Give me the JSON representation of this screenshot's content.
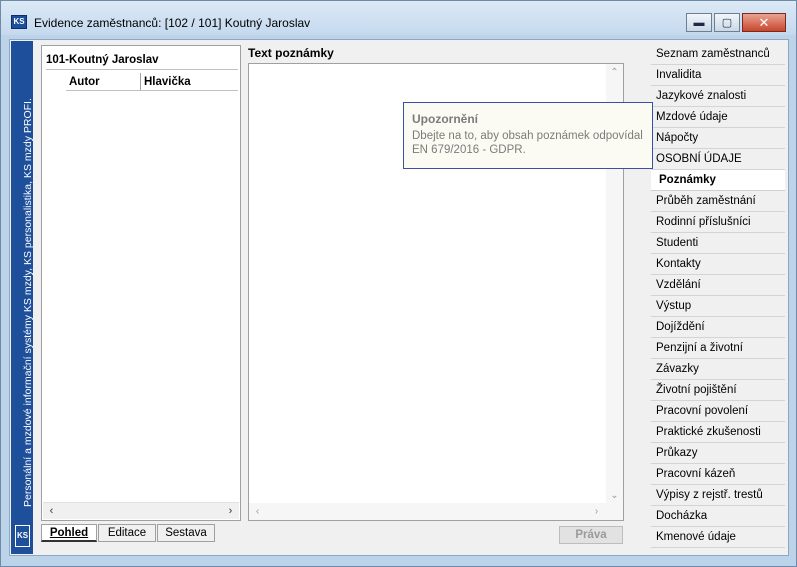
{
  "window": {
    "title": "Evidence zaměstnanců: [102 / 101] Koutný Jaroslav",
    "icon_label": "KS",
    "buttons": {
      "minimize": "▬",
      "maximize": "▢",
      "close": "✕"
    }
  },
  "brand": {
    "vertical_text": "Personální a mzdové informační systémy KS mzdy, KS personalistika, KS mzdy PROFI.",
    "logo": "KS",
    "color": "#1d4f9a"
  },
  "tree": {
    "root_item": "101-Koutný Jaroslav",
    "columns": [
      "Autor",
      "Hlavička"
    ]
  },
  "bottom_tabs": [
    {
      "label": "Pohled",
      "active": true
    },
    {
      "label": "Editace",
      "active": false
    },
    {
      "label": "Sestava",
      "active": false
    }
  ],
  "note": {
    "label": "Text poznámky",
    "content": ""
  },
  "rights_button": "Práva",
  "tooltip": {
    "title": "Upozornění",
    "body": "Dbejte na to, aby obsah poznámek odpovídal EN 679/2016 - GDPR.",
    "border_color": "#3a4fa8"
  },
  "menu": [
    {
      "label": "Seznam zaměstnanců",
      "active": false
    },
    {
      "label": "Invalidita",
      "active": false
    },
    {
      "label": "Jazykové znalosti",
      "active": false
    },
    {
      "label": "Mzdové údaje",
      "active": false
    },
    {
      "label": "Nápočty",
      "active": false
    },
    {
      "label": "OSOBNÍ ÚDAJE",
      "active": false
    },
    {
      "label": "Poznámky",
      "active": true
    },
    {
      "label": "Průběh zaměstnání",
      "active": false
    },
    {
      "label": "Rodinní příslušníci",
      "active": false
    },
    {
      "label": "Studenti",
      "active": false
    },
    {
      "label": "Kontakty",
      "active": false
    },
    {
      "label": "Vzdělání",
      "active": false
    },
    {
      "label": "Výstup",
      "active": false
    },
    {
      "label": "Dojíždění",
      "active": false
    },
    {
      "label": "Penzijní a životní",
      "active": false
    },
    {
      "label": "Závazky",
      "active": false
    },
    {
      "label": "Životní pojištění",
      "active": false
    },
    {
      "label": "Pracovní povolení",
      "active": false
    },
    {
      "label": "Praktické zkušenosti",
      "active": false
    },
    {
      "label": "Průkazy",
      "active": false
    },
    {
      "label": "Pracovní kázeň",
      "active": false
    },
    {
      "label": "Výpisy z rejstř. trestů",
      "active": false
    },
    {
      "label": "Docházka",
      "active": false
    },
    {
      "label": "Kmenové údaje",
      "active": false
    }
  ]
}
